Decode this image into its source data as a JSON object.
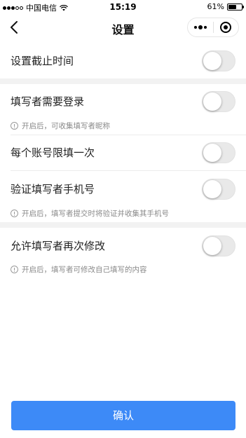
{
  "status_bar": {
    "carrier": "中国电信",
    "time": "15:19",
    "battery_text": "61%",
    "battery_level": 0.61,
    "icons": [
      "signal-dots-icon",
      "wifi-icon",
      "battery-icon"
    ]
  },
  "nav": {
    "title": "设置",
    "icons": [
      "back-chevron-icon",
      "more-dots-icon",
      "mini-program-close-icon"
    ]
  },
  "settings": {
    "deadline": {
      "label": "设置截止时间",
      "enabled": false
    },
    "login_required": {
      "label": "填写者需要登录",
      "enabled": false,
      "hint": "开启后，可收集填写者昵称"
    },
    "once_per_account": {
      "label": "每个账号限填一次",
      "enabled": false
    },
    "verify_phone": {
      "label": "验证填写者手机号",
      "enabled": false,
      "hint": "开启后，填写者提交时将验证并收集其手机号"
    },
    "allow_modify": {
      "label": "允许填写者再次修改",
      "enabled": false,
      "hint": "开启后，填写者可修改自己填写的内容"
    }
  },
  "confirm_label": "确认",
  "colors": {
    "primary": "#3d8af7",
    "switch_off": "#e9e9e9",
    "section_gap": "#f2f2f2",
    "hint_text": "#8a8a8a"
  }
}
